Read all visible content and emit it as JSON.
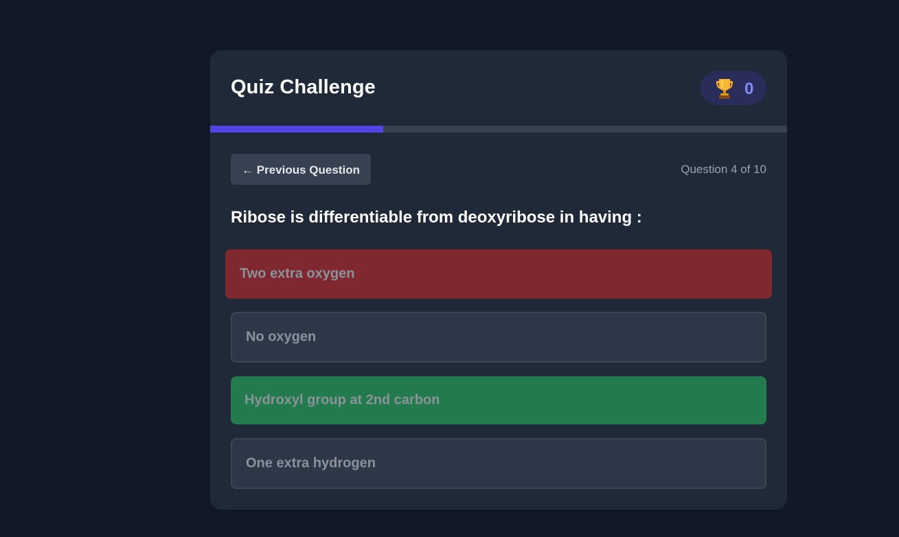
{
  "header": {
    "title": "Quiz Challenge",
    "score": "0",
    "score_icon": "trophy-icon"
  },
  "progress": {
    "fraction": 0.3
  },
  "nav": {
    "previous_label": "← Previous Question",
    "counter": "Question 4 of 10"
  },
  "question": {
    "text": "Ribose is differentiable from deoxyribose in having :"
  },
  "options": [
    {
      "label": "Two extra oxygen",
      "state": "incorrect"
    },
    {
      "label": "No oxygen",
      "state": "neutral"
    },
    {
      "label": "Hydroxyl group at 2nd carbon",
      "state": "correct"
    },
    {
      "label": "One extra hydrogen",
      "state": "neutral"
    }
  ],
  "colors": {
    "accent": "#4f46e5",
    "incorrect": "#7f2830",
    "correct": "#227a4d",
    "background": "#111827",
    "card": "#1f2937"
  }
}
